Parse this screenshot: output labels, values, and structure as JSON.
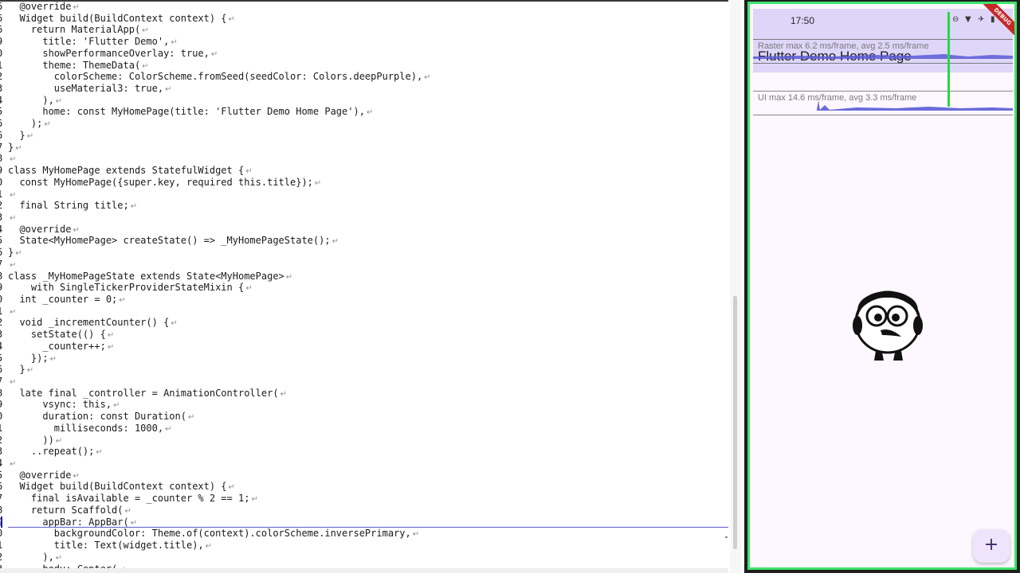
{
  "editor": {
    "lines": [
      {
        "ln": "6",
        "text": "  @override"
      },
      {
        "ln": "6",
        "text": "  Widget build(BuildContext context) {"
      },
      {
        "ln": "6",
        "text": "    return MaterialApp("
      },
      {
        "ln": "9",
        "text": "      title: 'Flutter Demo',"
      },
      {
        "ln": "0",
        "text": "      showPerformanceOverlay: true,"
      },
      {
        "ln": "1",
        "text": "      theme: ThemeData("
      },
      {
        "ln": "2",
        "text": "        colorScheme: ColorScheme.fromSeed(seedColor: Colors.deepPurple),"
      },
      {
        "ln": "3",
        "text": "        useMaterial3: true,"
      },
      {
        "ln": "4",
        "text": "      ),"
      },
      {
        "ln": "5",
        "text": "      home: const MyHomePage(title: 'Flutter Demo Home Page'),"
      },
      {
        "ln": "6",
        "text": "    );"
      },
      {
        "ln": "6",
        "text": "  }"
      },
      {
        "ln": "7",
        "text": "}"
      },
      {
        "ln": "8",
        "text": ""
      },
      {
        "ln": "9",
        "text": "class MyHomePage extends StatefulWidget {"
      },
      {
        "ln": "0",
        "text": "  const MyHomePage({super.key, required this.title});"
      },
      {
        "ln": "1",
        "text": ""
      },
      {
        "ln": "2",
        "text": "  final String title;"
      },
      {
        "ln": "3",
        "text": ""
      },
      {
        "ln": "4",
        "text": "  @override"
      },
      {
        "ln": "5",
        "text": "  State<MyHomePage> createState() => _MyHomePageState();"
      },
      {
        "ln": "6",
        "text": "}"
      },
      {
        "ln": "7",
        "text": ""
      },
      {
        "ln": "8",
        "text": "class _MyHomePageState extends State<MyHomePage>"
      },
      {
        "ln": "9",
        "text": "    with SingleTickerProviderStateMixin {"
      },
      {
        "ln": "0",
        "text": "  int _counter = 0;"
      },
      {
        "ln": "1",
        "text": ""
      },
      {
        "ln": "2",
        "text": "  void _incrementCounter() {"
      },
      {
        "ln": "3",
        "text": "    setState(() {"
      },
      {
        "ln": "4",
        "text": "      _counter++;"
      },
      {
        "ln": "5",
        "text": "    });"
      },
      {
        "ln": "6",
        "text": "  }"
      },
      {
        "ln": "7",
        "text": ""
      },
      {
        "ln": "8",
        "text": "  late final _controller = AnimationController("
      },
      {
        "ln": "9",
        "text": "      vsync: this,"
      },
      {
        "ln": "0",
        "text": "      duration: const Duration("
      },
      {
        "ln": "1",
        "text": "        milliseconds: 1000,"
      },
      {
        "ln": "2",
        "text": "      ))"
      },
      {
        "ln": "3",
        "text": "    ..repeat();"
      },
      {
        "ln": "4",
        "text": ""
      },
      {
        "ln": "5",
        "text": "  @override"
      },
      {
        "ln": "6",
        "text": "  Widget build(BuildContext context) {"
      },
      {
        "ln": "7",
        "text": "    final isAvailable = _counter % 2 == 1;"
      },
      {
        "ln": "8",
        "text": "    return Scaffold("
      },
      {
        "ln": "9",
        "text": "      appBar: AppBar(",
        "current": true
      },
      {
        "ln": "0",
        "text": "        backgroundColor: Theme.of(context).colorScheme.inversePrimary,"
      },
      {
        "ln": "1",
        "text": "        title: Text(widget.title),"
      },
      {
        "ln": "2",
        "text": "      ),"
      },
      {
        "ln": "3",
        "text": "      body: Center("
      }
    ],
    "eol_glyph": "↵"
  },
  "phone": {
    "status_time": "17:50",
    "debug_banner": "DEBUG",
    "app_title": "Flutter Demo Home Page",
    "perf_raster": "Raster  max 6.2 ms/frame, avg 2.5 ms/frame",
    "perf_ui": "UI  max 14.6 ms/frame, avg 3.3 ms/frame",
    "fab_label": "+",
    "status_icons": [
      "do-not-disturb-icon",
      "wifi-icon",
      "airplane-icon",
      "battery-icon"
    ]
  },
  "colors": {
    "appbar": "#ddd6f8",
    "screen_bg": "#fdf7ff",
    "border": "#3ee36a",
    "graph_fill": "#5b5bd6",
    "fab": "#efe4fb"
  }
}
